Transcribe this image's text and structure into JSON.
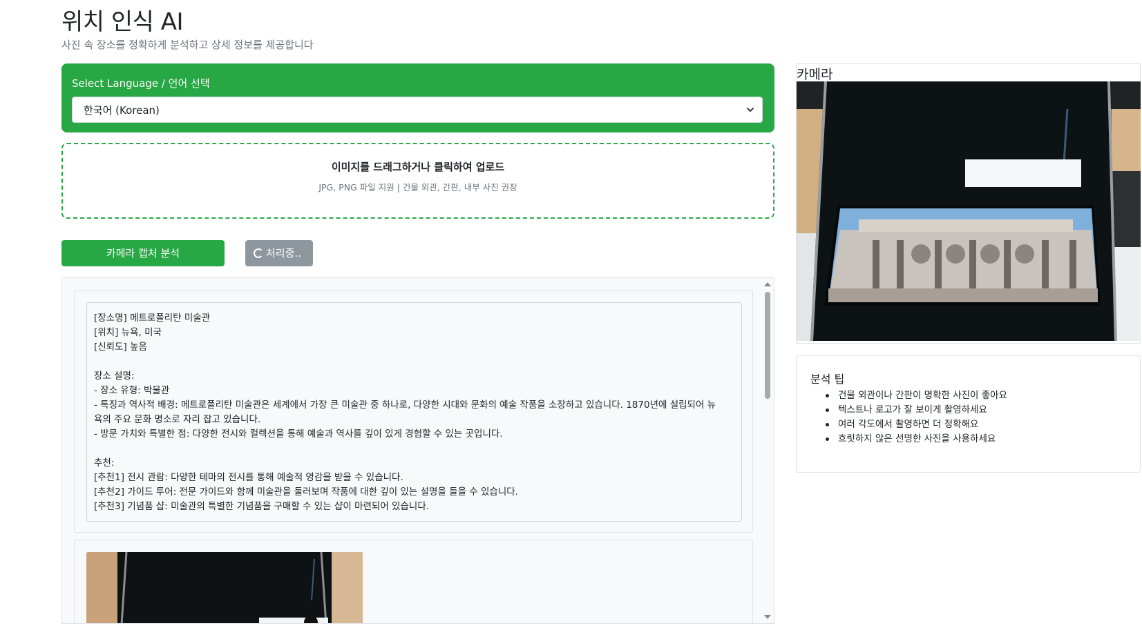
{
  "header": {
    "title": "위치 인식 AI",
    "subtitle": "사진 속 장소를 정확하게 분석하고 상세 정보를 제공합니다"
  },
  "language": {
    "label": "Select Language / 언어 선택",
    "selected": "한국어 (Korean)"
  },
  "upload": {
    "title": "이미지를 드래그하거나 클릭하여 업로드",
    "hint": "JPG, PNG 파일 지원 | 건물 외관, 간판, 내부 사진 권장"
  },
  "actions": {
    "capture_label": "카메라 캡처 분석",
    "processing_label": "처리중.."
  },
  "result": {
    "lines": [
      "[장소명] 메트로폴리탄 미술관",
      "[위치] 뉴욕, 미국",
      "[신뢰도] 높음",
      "",
      "장소 설명:",
      "- 장소 유형: 박물관",
      "- 특징과 역사적 배경: 메트로폴리탄 미술관은 세계에서 가장 큰 미술관 중 하나로, 다양한 시대와 문화의 예술 작품을 소장하고 있습니다. 1870년에 설립되어 뉴",
      "욕의 주요 문화 명소로 자리 잡고 있습니다.",
      "- 방문 가치와 특별한 점: 다양한 전시와 컬렉션을 통해 예술과 역사를 깊이 있게 경험할 수 있는 곳입니다.",
      "",
      "추천:",
      "[추천1] 전시 관람: 다양한 테마의 전시를 통해 예술적 영감을 받을 수 있습니다.",
      "[추천2] 가이드 투어: 전문 가이드와 함께 미술관을 둘러보며 작품에 대한 깊이 있는 설명을 들을 수 있습니다.",
      "[추천3] 기념품 샵: 미술관의 특별한 기념품을 구매할 수 있는 샵이 마련되어 있습니다."
    ]
  },
  "camera": {
    "title": "카메라"
  },
  "tips": {
    "title": "분석 팁",
    "items": [
      "건물 외관이나 간판이 명확한 사진이 좋아요",
      "텍스트나 로고가 잘 보이게 촬영하세요",
      "여러 각도에서 촬영하면 더 정확해요",
      "흐릿하지 않은 선명한 사진을 사용하세요"
    ]
  },
  "colors": {
    "accent": "#28a745",
    "muted": "#6c757d",
    "disabled": "#8f979e"
  }
}
